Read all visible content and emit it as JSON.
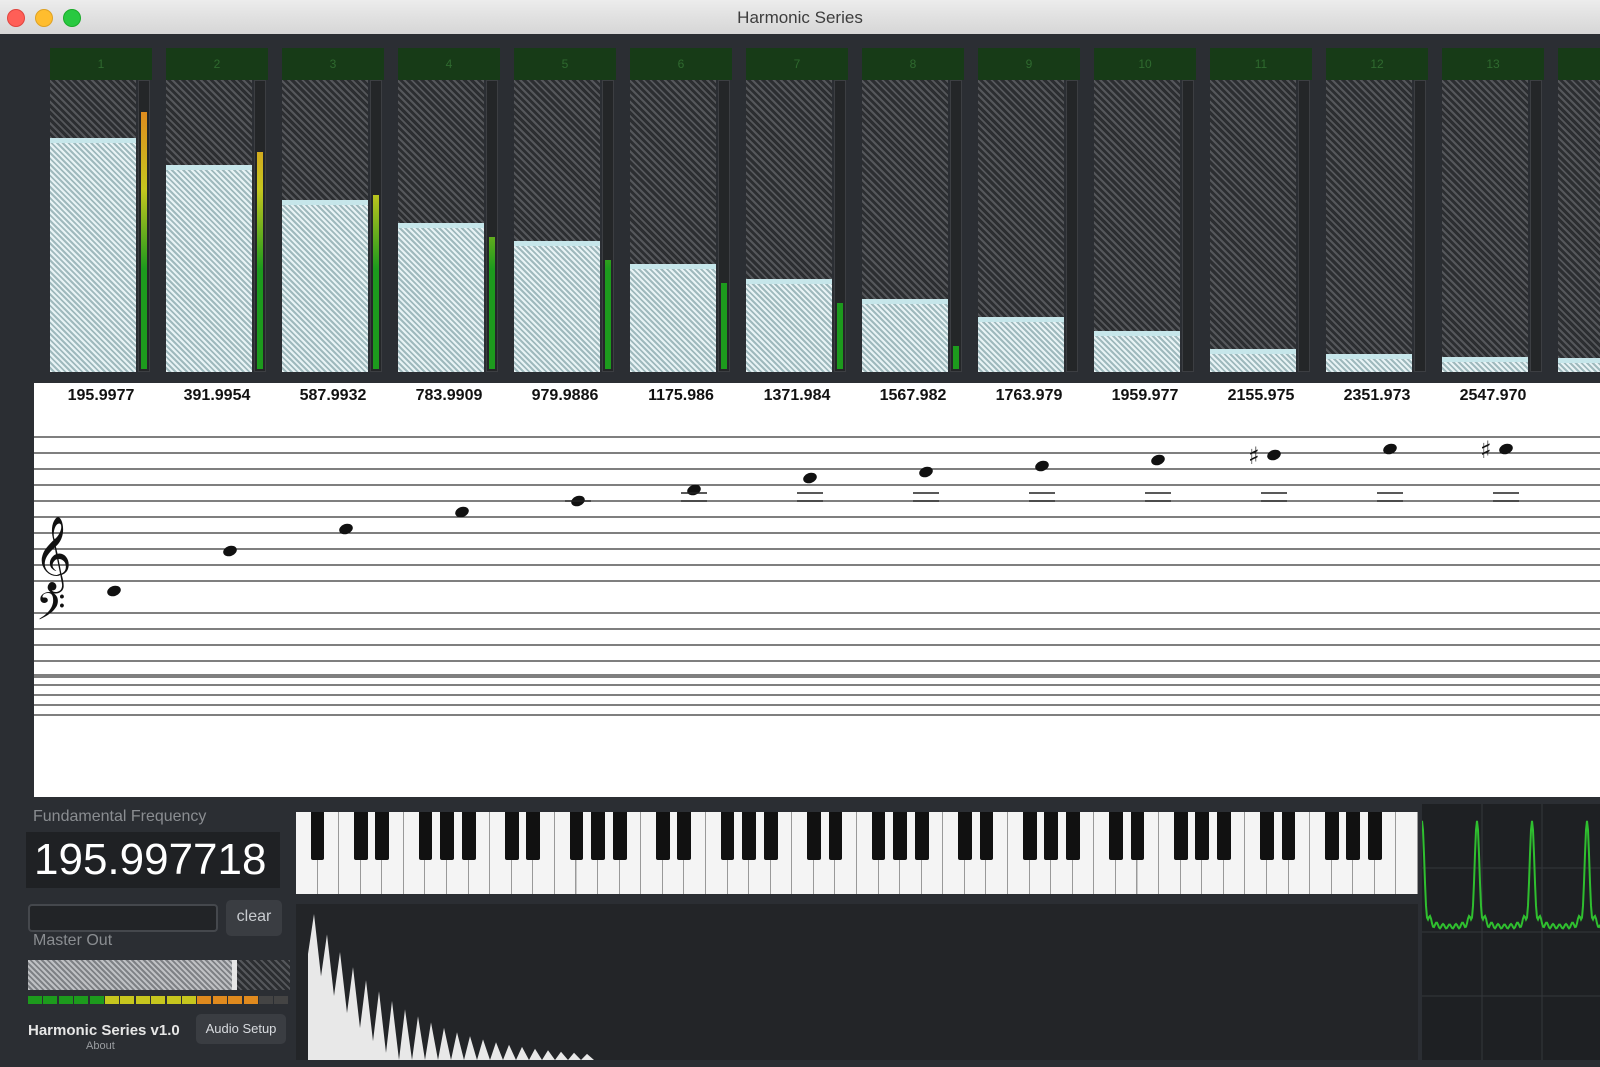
{
  "window": {
    "title": "Harmonic Series",
    "icons": [
      "close-icon",
      "minimize-icon",
      "maximize-icon"
    ]
  },
  "harmonics": [
    {
      "number": "1",
      "level": 0.8,
      "meter": 0.9,
      "frequency": "195.9977"
    },
    {
      "number": "2",
      "level": 0.71,
      "meter": 0.76,
      "frequency": "391.9954"
    },
    {
      "number": "3",
      "level": 0.59,
      "meter": 0.61,
      "frequency": "587.9932"
    },
    {
      "number": "4",
      "level": 0.51,
      "meter": 0.46,
      "frequency": "783.9909"
    },
    {
      "number": "5",
      "level": 0.45,
      "meter": 0.38,
      "frequency": "979.9886"
    },
    {
      "number": "6",
      "level": 0.37,
      "meter": 0.3,
      "frequency": "1175.986"
    },
    {
      "number": "7",
      "level": 0.32,
      "meter": 0.23,
      "frequency": "1371.984"
    },
    {
      "number": "8",
      "level": 0.25,
      "meter": 0.08,
      "frequency": "1567.982"
    },
    {
      "number": "9",
      "level": 0.19,
      "meter": 0.0,
      "frequency": "1763.979"
    },
    {
      "number": "10",
      "level": 0.14,
      "meter": 0.0,
      "frequency": "1959.977"
    },
    {
      "number": "11",
      "level": 0.08,
      "meter": 0.0,
      "frequency": "2155.975"
    },
    {
      "number": "12",
      "level": 0.06,
      "meter": 0.0,
      "frequency": "2351.973"
    },
    {
      "number": "13",
      "level": 0.05,
      "meter": 0.0,
      "frequency": "2547.970"
    }
  ],
  "controls": {
    "fundamental_label": "Fundamental Frequency",
    "fundamental_value": "195.997718",
    "note_input_value": "",
    "clear_label": "clear",
    "master_label": "Master Out",
    "master_level": 0.78,
    "app_name": "Harmonic Series v1.0",
    "about_label": "About",
    "audio_setup_label": "Audio Setup"
  },
  "colors": {
    "harmonic_header": "#173b17",
    "meter_green": "#1d9a1d",
    "meter_yellow": "#c6c61e",
    "meter_orange": "#e08a1e",
    "scope_line": "#2fbf2f",
    "spectrum_fill": "#e8e8e8"
  }
}
